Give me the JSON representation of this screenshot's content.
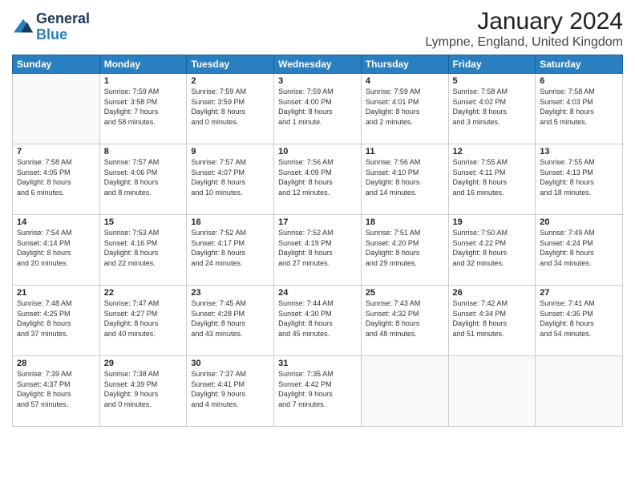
{
  "logo": {
    "line1": "General",
    "line2": "Blue"
  },
  "title": "January 2024",
  "subtitle": "Lympne, England, United Kingdom",
  "headers": [
    "Sunday",
    "Monday",
    "Tuesday",
    "Wednesday",
    "Thursday",
    "Friday",
    "Saturday"
  ],
  "weeks": [
    [
      {
        "day": "",
        "info": ""
      },
      {
        "day": "1",
        "info": "Sunrise: 7:59 AM\nSunset: 3:58 PM\nDaylight: 7 hours\nand 58 minutes."
      },
      {
        "day": "2",
        "info": "Sunrise: 7:59 AM\nSunset: 3:59 PM\nDaylight: 8 hours\nand 0 minutes."
      },
      {
        "day": "3",
        "info": "Sunrise: 7:59 AM\nSunset: 4:00 PM\nDaylight: 8 hours\nand 1 minute."
      },
      {
        "day": "4",
        "info": "Sunrise: 7:59 AM\nSunset: 4:01 PM\nDaylight: 8 hours\nand 2 minutes."
      },
      {
        "day": "5",
        "info": "Sunrise: 7:58 AM\nSunset: 4:02 PM\nDaylight: 8 hours\nand 3 minutes."
      },
      {
        "day": "6",
        "info": "Sunrise: 7:58 AM\nSunset: 4:03 PM\nDaylight: 8 hours\nand 5 minutes."
      }
    ],
    [
      {
        "day": "7",
        "info": "Sunrise: 7:58 AM\nSunset: 4:05 PM\nDaylight: 8 hours\nand 6 minutes."
      },
      {
        "day": "8",
        "info": "Sunrise: 7:57 AM\nSunset: 4:06 PM\nDaylight: 8 hours\nand 8 minutes."
      },
      {
        "day": "9",
        "info": "Sunrise: 7:57 AM\nSunset: 4:07 PM\nDaylight: 8 hours\nand 10 minutes."
      },
      {
        "day": "10",
        "info": "Sunrise: 7:56 AM\nSunset: 4:09 PM\nDaylight: 8 hours\nand 12 minutes."
      },
      {
        "day": "11",
        "info": "Sunrise: 7:56 AM\nSunset: 4:10 PM\nDaylight: 8 hours\nand 14 minutes."
      },
      {
        "day": "12",
        "info": "Sunrise: 7:55 AM\nSunset: 4:11 PM\nDaylight: 8 hours\nand 16 minutes."
      },
      {
        "day": "13",
        "info": "Sunrise: 7:55 AM\nSunset: 4:13 PM\nDaylight: 8 hours\nand 18 minutes."
      }
    ],
    [
      {
        "day": "14",
        "info": "Sunrise: 7:54 AM\nSunset: 4:14 PM\nDaylight: 8 hours\nand 20 minutes."
      },
      {
        "day": "15",
        "info": "Sunrise: 7:53 AM\nSunset: 4:16 PM\nDaylight: 8 hours\nand 22 minutes."
      },
      {
        "day": "16",
        "info": "Sunrise: 7:52 AM\nSunset: 4:17 PM\nDaylight: 8 hours\nand 24 minutes."
      },
      {
        "day": "17",
        "info": "Sunrise: 7:52 AM\nSunset: 4:19 PM\nDaylight: 8 hours\nand 27 minutes."
      },
      {
        "day": "18",
        "info": "Sunrise: 7:51 AM\nSunset: 4:20 PM\nDaylight: 8 hours\nand 29 minutes."
      },
      {
        "day": "19",
        "info": "Sunrise: 7:50 AM\nSunset: 4:22 PM\nDaylight: 8 hours\nand 32 minutes."
      },
      {
        "day": "20",
        "info": "Sunrise: 7:49 AM\nSunset: 4:24 PM\nDaylight: 8 hours\nand 34 minutes."
      }
    ],
    [
      {
        "day": "21",
        "info": "Sunrise: 7:48 AM\nSunset: 4:25 PM\nDaylight: 8 hours\nand 37 minutes."
      },
      {
        "day": "22",
        "info": "Sunrise: 7:47 AM\nSunset: 4:27 PM\nDaylight: 8 hours\nand 40 minutes."
      },
      {
        "day": "23",
        "info": "Sunrise: 7:45 AM\nSunset: 4:28 PM\nDaylight: 8 hours\nand 43 minutes."
      },
      {
        "day": "24",
        "info": "Sunrise: 7:44 AM\nSunset: 4:30 PM\nDaylight: 8 hours\nand 45 minutes."
      },
      {
        "day": "25",
        "info": "Sunrise: 7:43 AM\nSunset: 4:32 PM\nDaylight: 8 hours\nand 48 minutes."
      },
      {
        "day": "26",
        "info": "Sunrise: 7:42 AM\nSunset: 4:34 PM\nDaylight: 8 hours\nand 51 minutes."
      },
      {
        "day": "27",
        "info": "Sunrise: 7:41 AM\nSunset: 4:35 PM\nDaylight: 8 hours\nand 54 minutes."
      }
    ],
    [
      {
        "day": "28",
        "info": "Sunrise: 7:39 AM\nSunset: 4:37 PM\nDaylight: 8 hours\nand 57 minutes."
      },
      {
        "day": "29",
        "info": "Sunrise: 7:38 AM\nSunset: 4:39 PM\nDaylight: 9 hours\nand 0 minutes."
      },
      {
        "day": "30",
        "info": "Sunrise: 7:37 AM\nSunset: 4:41 PM\nDaylight: 9 hours\nand 4 minutes."
      },
      {
        "day": "31",
        "info": "Sunrise: 7:35 AM\nSunset: 4:42 PM\nDaylight: 9 hours\nand 7 minutes."
      },
      {
        "day": "",
        "info": ""
      },
      {
        "day": "",
        "info": ""
      },
      {
        "day": "",
        "info": ""
      }
    ]
  ]
}
